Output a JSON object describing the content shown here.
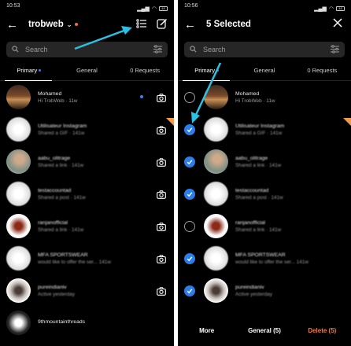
{
  "left": {
    "status_time": "10:53",
    "battery": "48",
    "title": "trobweb",
    "search_placeholder": "Search",
    "tabs": [
      "Primary",
      "General",
      "0 Requests"
    ],
    "rows": [
      {
        "name": "Mohamed",
        "sub": "Hi TrobWeb · 11w",
        "avatar": "sunset",
        "blur": false,
        "unread": true
      },
      {
        "name": "Utilisateur Instagram",
        "sub": "Shared a GIF · 141w",
        "avatar": "blur",
        "blur": true,
        "unread": false
      },
      {
        "name": "aabu_olitrage",
        "sub": "Shared a link · 141w",
        "avatar": "person",
        "blur": true,
        "unread": false
      },
      {
        "name": "testaccountad",
        "sub": "Shared a post · 141w",
        "avatar": "blur",
        "blur": true,
        "unread": false
      },
      {
        "name": "ranjanofficial",
        "sub": "Shared a link · 141w",
        "avatar": "red",
        "blur": true,
        "unread": false
      },
      {
        "name": "MFA SPORTSWEAR",
        "sub": "would like to offer the ser... 141w",
        "avatar": "blur",
        "blur": true,
        "unread": false
      },
      {
        "name": "pureindianiv",
        "sub": "Active yesterday",
        "avatar": "photo",
        "blur": true,
        "unread": false
      },
      {
        "name": "9thmountainthreads",
        "sub": "",
        "avatar": "dark",
        "blur": false,
        "unread": false
      }
    ]
  },
  "right": {
    "status_time": "10:56",
    "battery": "48",
    "title": "5 Selected",
    "search_placeholder": "Search",
    "tabs": [
      "Primary",
      "General",
      "0 Requests"
    ],
    "rows": [
      {
        "name": "Mohamed",
        "sub": "Hi TrobWeb · 11w",
        "avatar": "sunset",
        "checked": false,
        "blur": false
      },
      {
        "name": "Utilisateur Instagram",
        "sub": "Shared a GIF · 141w",
        "avatar": "blur",
        "checked": true,
        "blur": true
      },
      {
        "name": "aabu_olitrage",
        "sub": "Shared a link · 141w",
        "avatar": "person",
        "checked": true,
        "blur": true
      },
      {
        "name": "testaccountad",
        "sub": "Shared a post · 141w",
        "avatar": "blur",
        "checked": true,
        "blur": true
      },
      {
        "name": "ranjanofficial",
        "sub": "Shared a link · 141w",
        "avatar": "red",
        "checked": false,
        "blur": true
      },
      {
        "name": "MFA SPORTSWEAR",
        "sub": "would like to offer the ser... 141w",
        "avatar": "blur",
        "checked": true,
        "blur": true
      },
      {
        "name": "pureindianiv",
        "sub": "Active yesterday",
        "avatar": "photo",
        "checked": true,
        "blur": true
      }
    ],
    "bottom": {
      "more": "More",
      "general": "General (5)",
      "delete": "Delete (5)"
    }
  },
  "colors": {
    "accent_blue": "#2b7de9",
    "arrow_cyan": "#2bc0e4",
    "delete_orange": "#ee7b3c"
  }
}
